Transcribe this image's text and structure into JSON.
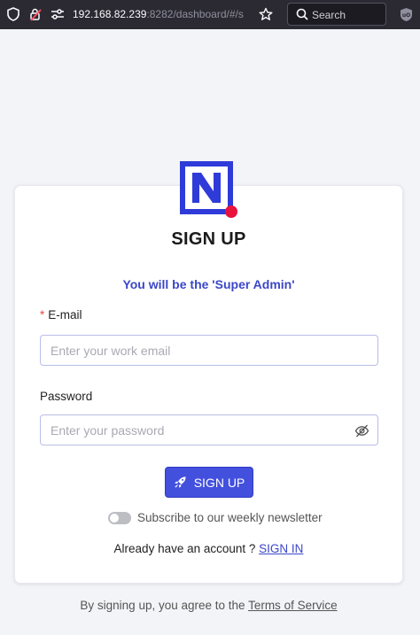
{
  "browser": {
    "url_host": "192.168.82.239",
    "url_rest": ":8282/dashboard/#/s",
    "search_placeholder": "Search"
  },
  "form": {
    "title": "SIGN UP",
    "subtitle": "You will be the 'Super Admin'",
    "required_mark": "*",
    "email_label": "E-mail",
    "email_placeholder": "Enter your work email",
    "password_label": "Password",
    "password_placeholder": "Enter your password",
    "submit_label": "SIGN UP",
    "newsletter_label": "Subscribe to our weekly newsletter",
    "newsletter_enabled": false,
    "already_text": "Already have an account ?",
    "signin_link": "SIGN IN"
  },
  "footer": {
    "terms_prefix": "By signing up, you agree to the",
    "terms_link": "Terms of Service"
  },
  "colors": {
    "accent": "#4350de",
    "logo_blue": "#2f3bd8",
    "logo_dot": "#e8123d"
  },
  "icons": [
    "shield-icon",
    "lock-warning-icon",
    "permissions-icon",
    "bookmark-star-icon",
    "search-icon",
    "extension-icon",
    "logo-icon",
    "eye-off-icon",
    "rocket-icon"
  ]
}
